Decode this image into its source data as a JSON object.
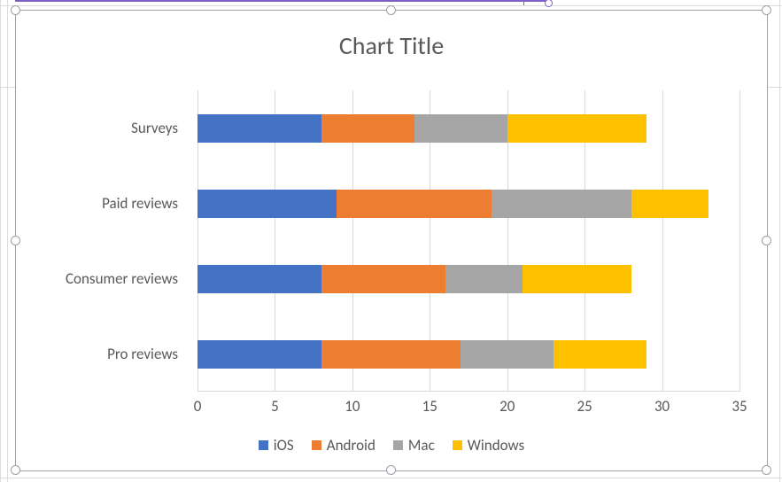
{
  "chart_data": {
    "type": "bar",
    "orientation": "horizontal",
    "stacked": true,
    "title": "Chart Title",
    "xlabel": "",
    "ylabel": "",
    "xlim": [
      0,
      35
    ],
    "x_ticks": [
      0,
      5,
      10,
      15,
      20,
      25,
      30,
      35
    ],
    "categories": [
      "Pro reviews",
      "Consumer reviews",
      "Paid reviews",
      "Surveys"
    ],
    "series": [
      {
        "name": "iOS",
        "color": "#4472C4",
        "values": [
          8,
          8,
          9,
          8
        ]
      },
      {
        "name": "Android",
        "color": "#ED7D31",
        "values": [
          9,
          8,
          10,
          6
        ]
      },
      {
        "name": "Mac",
        "color": "#A5A5A5",
        "values": [
          6,
          5,
          9,
          6
        ]
      },
      {
        "name": "Windows",
        "color": "#FFC000",
        "values": [
          6,
          7,
          5,
          9
        ]
      }
    ],
    "legend_position": "bottom",
    "grid": {
      "x": true,
      "y": false
    }
  },
  "ui": {
    "selection_state": "chart-selected"
  }
}
